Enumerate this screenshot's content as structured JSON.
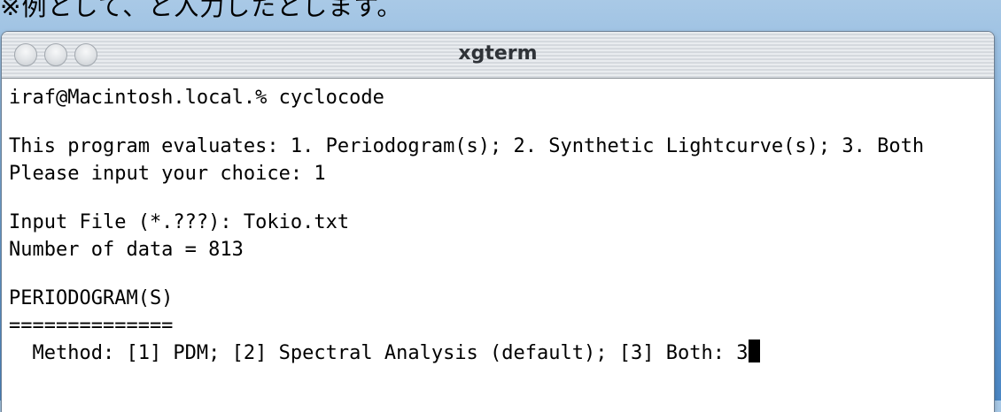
{
  "caption": "※例として、と入力したとします。",
  "window": {
    "title": "xgterm"
  },
  "terminal": {
    "lines": [
      "iraf@Macintosh.local.% cyclocode",
      "",
      "This program evaluates: 1. Periodogram(s); 2. Synthetic Lightcurve(s); 3. Both",
      "Please input your choice: 1",
      "",
      "Input File (*.???): Tokio.txt",
      "Number of data = 813",
      "",
      "PERIODOGRAM(S)",
      "==============",
      "  Method: [1] PDM; [2] Spectral Analysis (default); [3] Both: 3"
    ]
  }
}
